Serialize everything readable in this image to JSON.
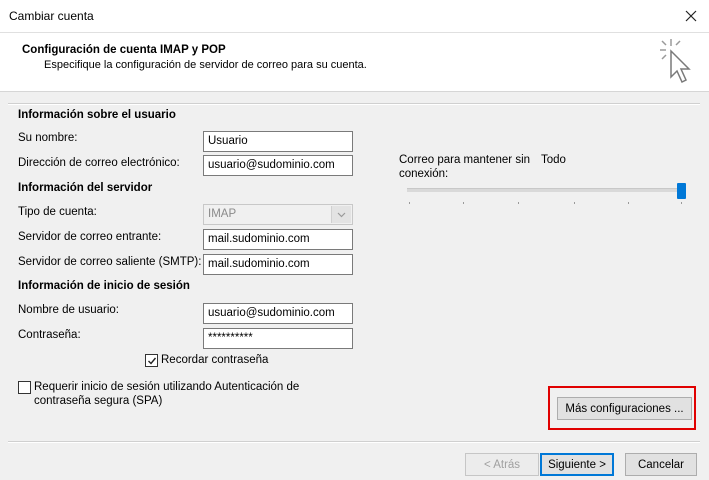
{
  "window": {
    "title": "Cambiar cuenta"
  },
  "header": {
    "title": "Configuración de cuenta IMAP y POP",
    "subtitle": "Especifique la configuración de servidor de correo para su cuenta."
  },
  "user_info": {
    "heading": "Información sobre el usuario",
    "name_label": "Su nombre:",
    "name_value": "Usuario",
    "email_label": "Dirección de correo electrónico:",
    "email_value": "usuario@sudominio.com"
  },
  "server_info": {
    "heading": "Información del servidor",
    "account_type_label": "Tipo de cuenta:",
    "account_type_value": "IMAP",
    "incoming_label": "Servidor de correo entrante:",
    "incoming_value": "mail.sudominio.com",
    "outgoing_label": "Servidor de correo saliente (SMTP):",
    "outgoing_value": "mail.sudominio.com"
  },
  "login_info": {
    "heading": "Información de inicio de sesión",
    "username_label": "Nombre de usuario:",
    "username_value": "usuario@sudominio.com",
    "password_label": "Contraseña:",
    "password_value": "**********",
    "remember_label": "Recordar contraseña",
    "remember_checked": true
  },
  "spa": {
    "label_line1": "Requerir inicio de sesión utilizando Autenticación de",
    "label_line2": "contraseña segura (SPA)",
    "checked": false
  },
  "offline": {
    "label_line1": "Correo para mantener sin",
    "label_line2": "conexión:",
    "value": "Todo",
    "slider_level": 1.0
  },
  "buttons": {
    "more_settings": "Más configuraciones ...",
    "back": "< Atrás",
    "next": "Siguiente >",
    "cancel": "Cancelar"
  },
  "colors": {
    "accent": "#0078d7",
    "highlight": "#e00000"
  },
  "icons": {
    "close": "close-icon",
    "cursor": "cursor-click-icon",
    "checkmark": "checkmark-icon",
    "dropdown": "chevron-down-icon"
  }
}
